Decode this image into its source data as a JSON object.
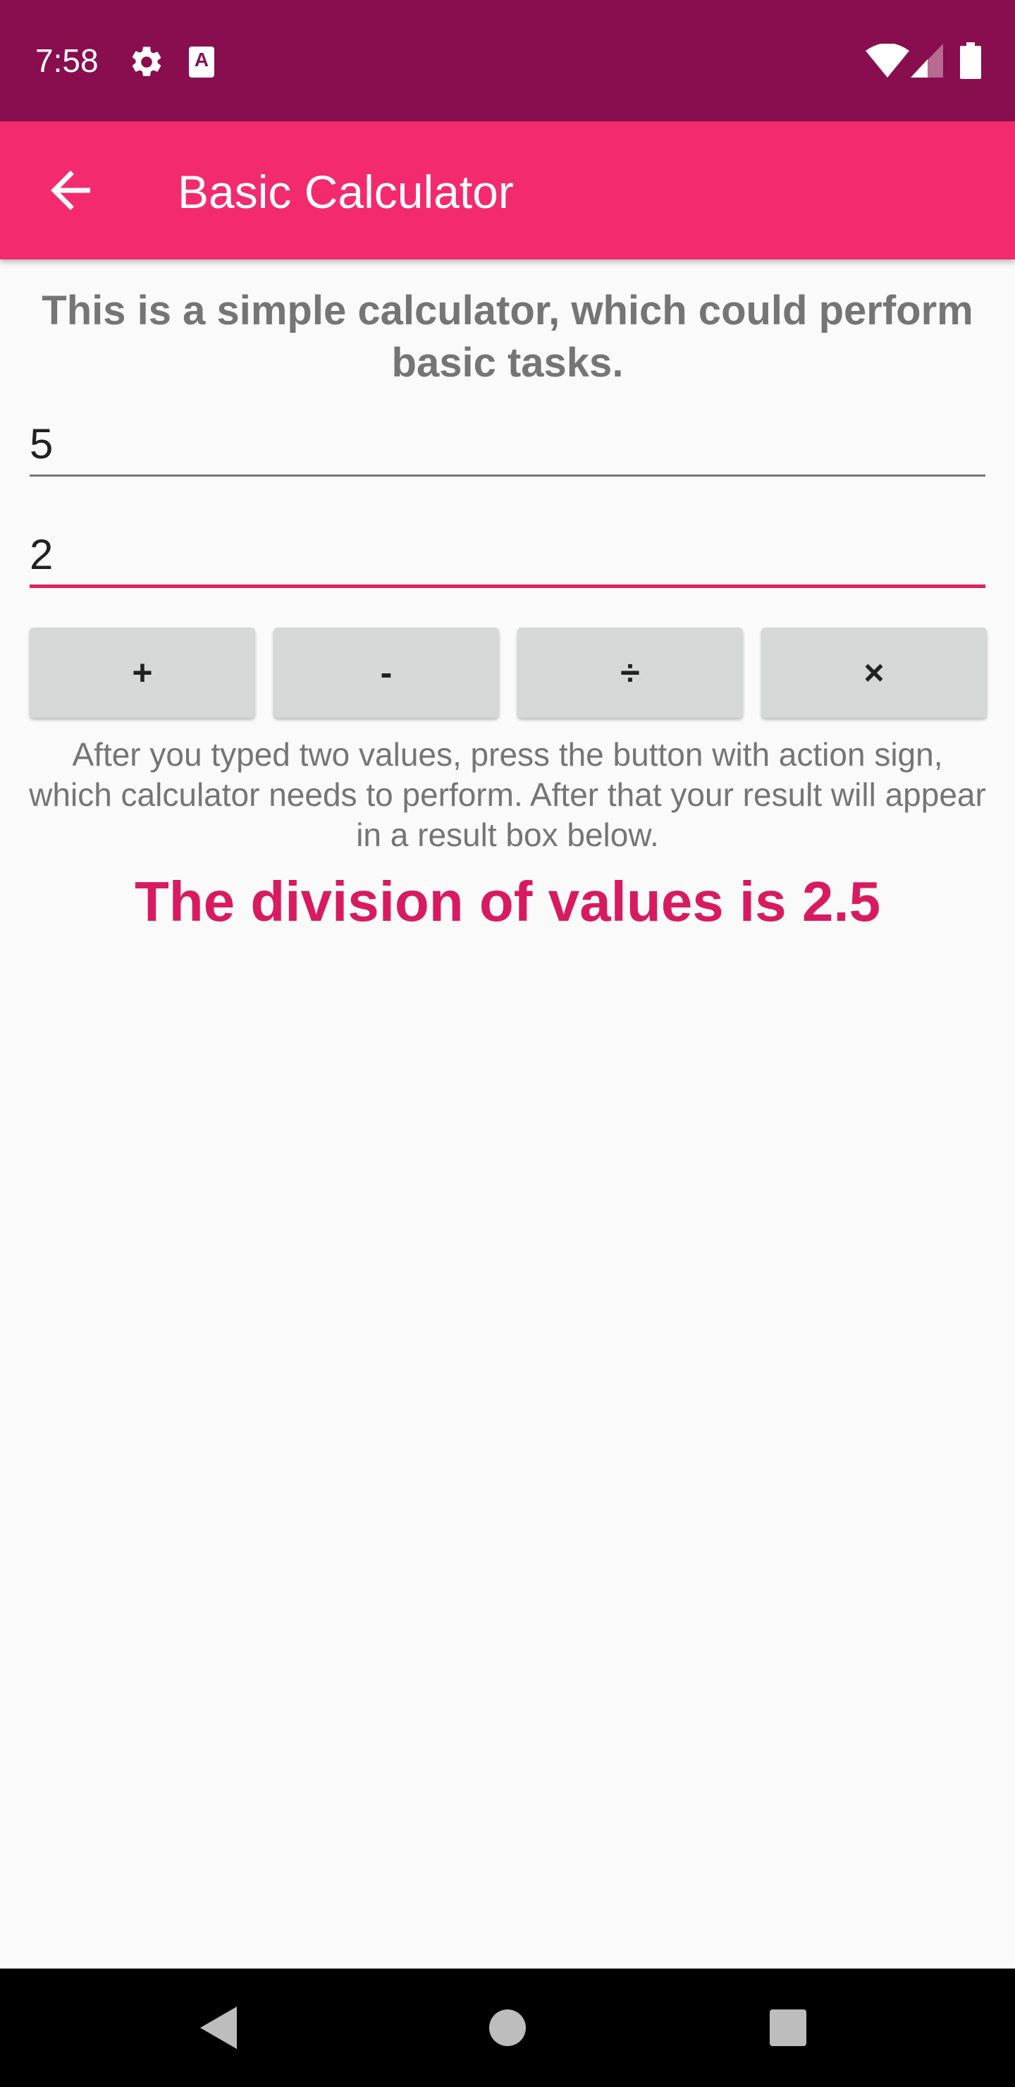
{
  "status_bar": {
    "time": "7:58",
    "icons": [
      "gear-icon",
      "keyboard-a-icon",
      "wifi-icon",
      "signal-icon",
      "battery-icon"
    ],
    "keyboard_letter": "A"
  },
  "app_bar": {
    "title": "Basic Calculator",
    "back_icon": "arrow-left-icon",
    "color": "#f42a6e"
  },
  "main": {
    "intro": "This is a simple calculator, which could perform basic tasks.",
    "first_value": "5",
    "second_value": "2",
    "buttons": {
      "add": "+",
      "subtract": "-",
      "divide": "÷",
      "multiply": "×"
    },
    "instructions": "After you typed two values, press the button with action sign, which calculator needs to perform. After that your result will appear in a result box below.",
    "result": "The division of values is 2.5",
    "result_color": "#d81b60"
  },
  "nav_bar": {
    "icons": [
      "back-triangle-icon",
      "home-circle-icon",
      "recents-square-icon"
    ]
  }
}
